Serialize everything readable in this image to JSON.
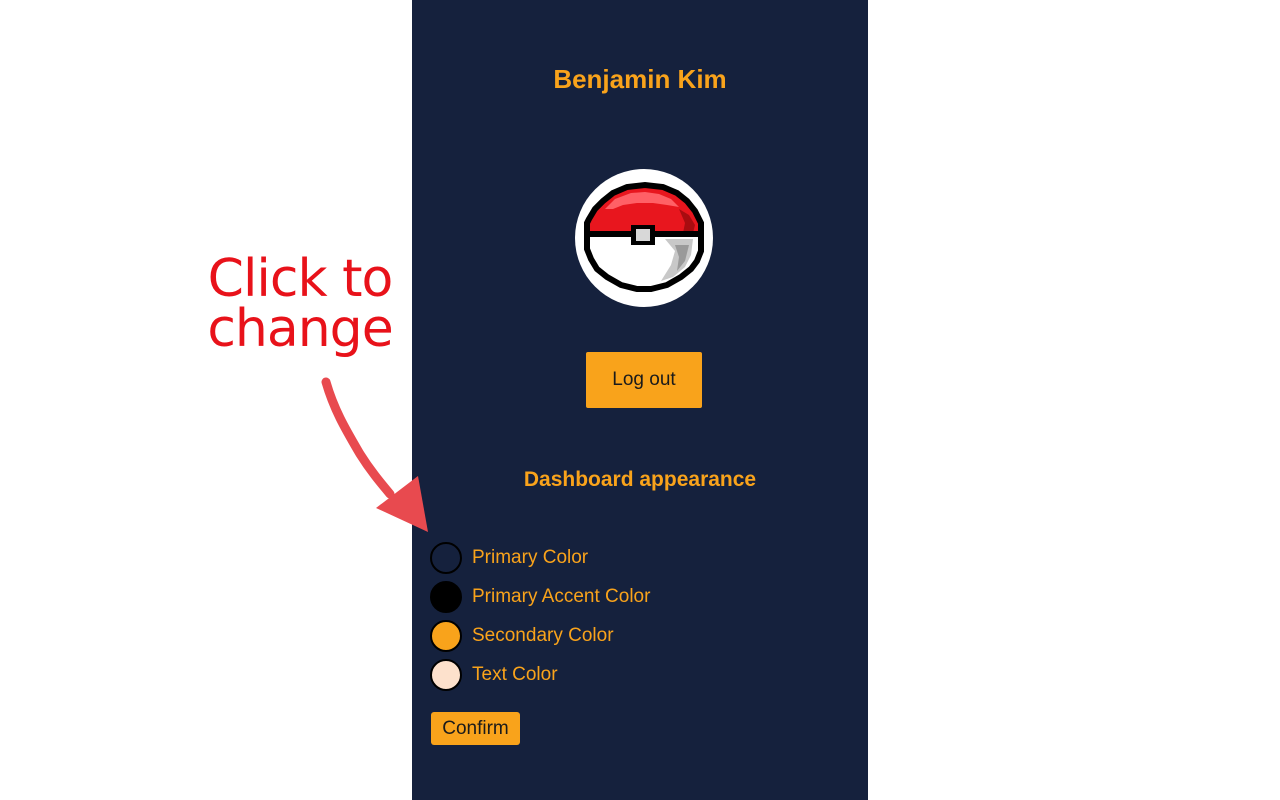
{
  "profile": {
    "name": "Benjamin Kim",
    "avatar_icon": "pokeball-icon",
    "logout_label": "Log out"
  },
  "appearance": {
    "title": "Dashboard appearance",
    "colors": [
      {
        "label": "Primary Color",
        "value": "#15213d"
      },
      {
        "label": "Primary Accent Color",
        "value": "#000000"
      },
      {
        "label": "Secondary Color",
        "value": "#f9a31b"
      },
      {
        "label": "Text Color",
        "value": "#fde1cc"
      }
    ],
    "confirm_label": "Confirm"
  },
  "annotation": {
    "line1": "Click to",
    "line2": "change",
    "color": "#e8121a",
    "arrow_color": "#e84a4f"
  },
  "theme": {
    "panel_bg": "#15213d",
    "accent": "#f9a31b"
  }
}
